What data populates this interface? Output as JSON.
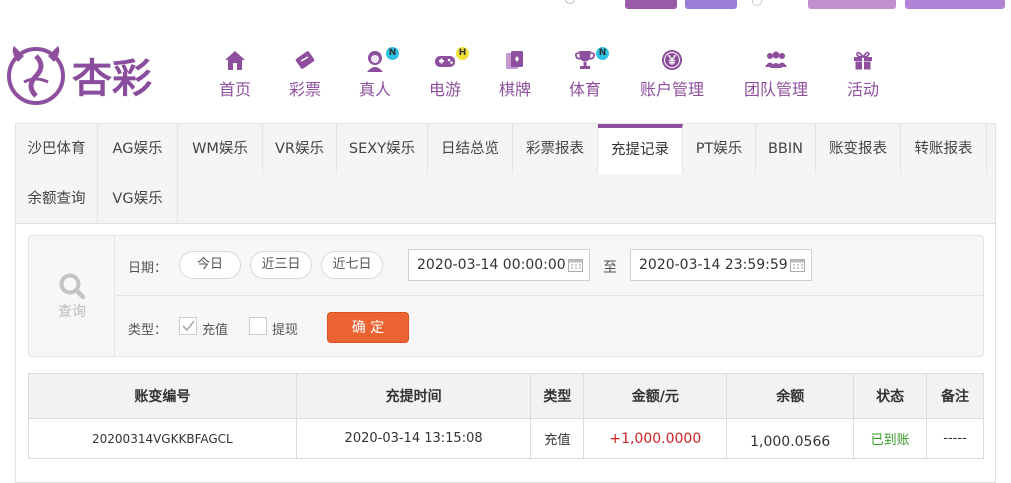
{
  "brand": {
    "name": "杏彩",
    "color": "#8e4f9e"
  },
  "nav": [
    {
      "label": "首页",
      "icon": "home-icon"
    },
    {
      "label": "彩票",
      "icon": "ticket-icon"
    },
    {
      "label": "真人",
      "icon": "live-dealer-icon",
      "badge": "N"
    },
    {
      "label": "电游",
      "icon": "gamepad-icon",
      "badge": "H"
    },
    {
      "label": "棋牌",
      "icon": "cards-icon"
    },
    {
      "label": "体育",
      "icon": "trophy-icon",
      "badge": "N"
    },
    {
      "label": "账户管理",
      "icon": "yen-coin-icon"
    },
    {
      "label": "团队管理",
      "icon": "team-icon"
    },
    {
      "label": "活动",
      "icon": "gift-icon"
    }
  ],
  "tabs": [
    "沙巴体育",
    "AG娱乐",
    "WM娱乐",
    "VR娱乐",
    "SEXY娱乐",
    "日结总览",
    "彩票报表",
    "充提记录",
    "PT娱乐",
    "BBIN",
    "账变报表",
    "转账报表",
    "余额查询",
    "VG娱乐"
  ],
  "active_tab": "充提记录",
  "search": {
    "side_label": "查询",
    "date_label": "日期：",
    "quick_ranges": [
      "今日",
      "近三日",
      "近七日"
    ],
    "start_datetime": "2020-03-14 00:00:00",
    "separator": "至",
    "end_datetime": "2020-03-14 23:59:59",
    "type_label": "类型：",
    "type_options": [
      {
        "label": "充值",
        "checked": true
      },
      {
        "label": "提现",
        "checked": false
      }
    ],
    "confirm_label": "确 定",
    "confirm_color": "#ea6330"
  },
  "table": {
    "columns": [
      "账变编号",
      "充提时间",
      "类型",
      "金额/元",
      "余额",
      "状态",
      "备注"
    ],
    "rows": [
      [
        "20200314VGKKBFAGCL",
        "2020-03-14 13:15:08",
        "充值",
        "+1,000.0000",
        "1,000.0566",
        "已到账",
        "-----"
      ]
    ]
  }
}
